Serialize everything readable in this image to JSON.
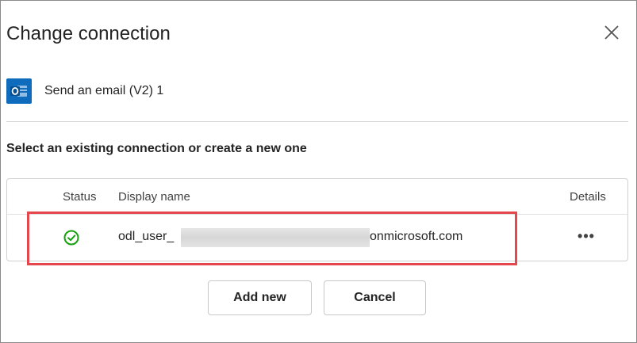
{
  "dialog": {
    "title": "Change connection",
    "close_icon": "close-icon"
  },
  "action": {
    "icon": "outlook-icon",
    "name": "Send an email (V2) 1"
  },
  "instruction": "Select an existing connection or create a new one",
  "table": {
    "columns": {
      "status": "Status",
      "display_name": "Display name",
      "details": "Details"
    },
    "rows": [
      {
        "status_icon": "check-circle-icon",
        "display_name_prefix": "odl_user_",
        "display_name_suffix": "onmicrosoft.com",
        "details_icon": "more-options-icon",
        "details_label": "•••"
      }
    ]
  },
  "buttons": {
    "add_new": "Add new",
    "cancel": "Cancel"
  },
  "colors": {
    "accent_outlook": "#0f6cbd",
    "success": "#13a10e",
    "highlight": "#e5474f"
  }
}
